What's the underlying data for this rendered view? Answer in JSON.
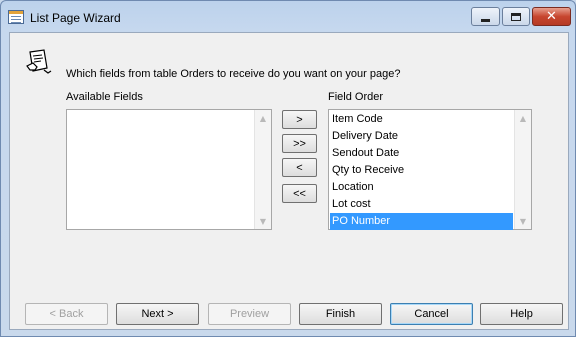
{
  "window": {
    "title": "List Page Wizard",
    "icon": "table-icon",
    "controls": {
      "minimize_icon": "minimize-icon",
      "maximize_icon": "maximize-icon",
      "close_icon": "close-icon",
      "close_glyph": "✕"
    }
  },
  "wizard": {
    "icon": "document-hand-icon",
    "question": "Which fields from table Orders to receive do you want on your page?"
  },
  "available_fields": {
    "label": "Available Fields",
    "items": []
  },
  "field_order": {
    "label": "Field Order",
    "items": [
      {
        "label": "Item Code",
        "selected": false
      },
      {
        "label": "Delivery Date",
        "selected": false
      },
      {
        "label": "Sendout Date",
        "selected": false
      },
      {
        "label": "Qty to Receive",
        "selected": false
      },
      {
        "label": "Location",
        "selected": false
      },
      {
        "label": "Lot cost",
        "selected": false
      },
      {
        "label": "PO Number",
        "selected": true
      }
    ]
  },
  "move_buttons": {
    "add": ">",
    "add_all": ">>",
    "remove": "<",
    "remove_all": "<<"
  },
  "footer": {
    "back": "< Back",
    "next": "Next >",
    "preview": "Preview",
    "finish": "Finish",
    "cancel": "Cancel",
    "help": "Help"
  },
  "scroll_arrows": {
    "up": "▲",
    "down": "▼"
  },
  "colors": {
    "selection": "#3399ff",
    "close_button": "#c7462f",
    "frame": "#c9d9ec"
  }
}
